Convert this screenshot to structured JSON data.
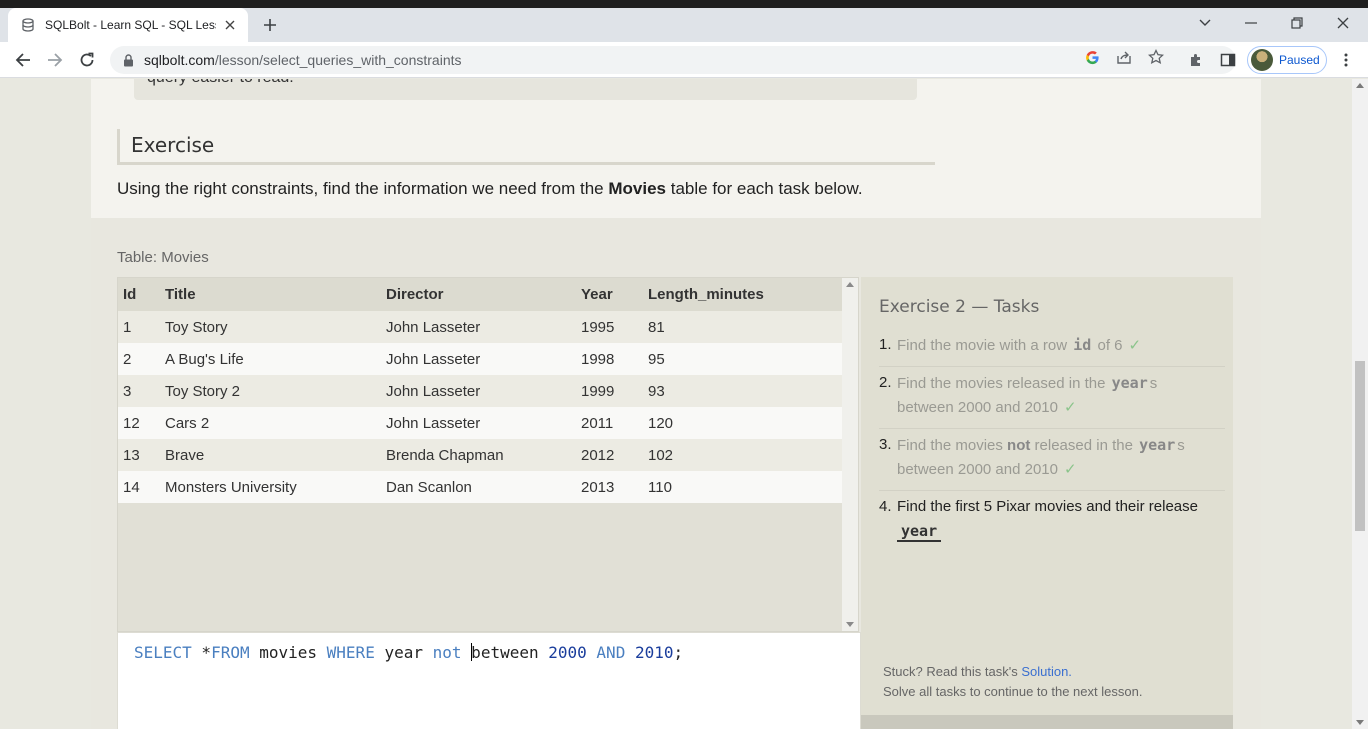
{
  "browser": {
    "tab_title": "SQLBolt - Learn SQL - SQL Lesson",
    "url_host": "sqlbolt.com",
    "url_path": "/lesson/select_queries_with_constraints",
    "profile_label": "Paused"
  },
  "page": {
    "note_fragment": "query easier to read.",
    "exercise_heading": "Exercise",
    "intro_before": "Using the right constraints, find the information we need from the ",
    "intro_bold": "Movies",
    "intro_after": " table for each task below.",
    "table_caption": "Table: Movies"
  },
  "table": {
    "headers": [
      "Id",
      "Title",
      "Director",
      "Year",
      "Length_minutes"
    ],
    "rows": [
      [
        "1",
        "Toy Story",
        "John Lasseter",
        "1995",
        "81"
      ],
      [
        "2",
        "A Bug's Life",
        "John Lasseter",
        "1998",
        "95"
      ],
      [
        "3",
        "Toy Story 2",
        "John Lasseter",
        "1999",
        "93"
      ],
      [
        "12",
        "Cars 2",
        "John Lasseter",
        "2011",
        "120"
      ],
      [
        "13",
        "Brave",
        "Brenda Chapman",
        "2012",
        "102"
      ],
      [
        "14",
        "Monsters University",
        "Dan Scanlon",
        "2013",
        "110"
      ]
    ]
  },
  "editor": {
    "tokens": {
      "select": "SELECT",
      "star": " *",
      "from": "FROM",
      "table": " movies ",
      "where": "WHERE",
      "col": " year ",
      "not": "not",
      "space": " ",
      "between_b": "b",
      "between_rest": "etween ",
      "n1": "2000",
      "and_pre": " ",
      "and": "AND",
      "and_post": " ",
      "n2": "2010",
      "semi": ";"
    }
  },
  "tasks": {
    "title": "Exercise 2 — Tasks",
    "items": [
      {
        "num": "1.",
        "pre": "Find the movie with a row ",
        "code": "id",
        "post": " of 6",
        "check": "✓"
      },
      {
        "num": "2.",
        "pre": "Find the movies released in the ",
        "code": "year",
        "post": "s between 2000 and 2010",
        "check": "✓"
      },
      {
        "num": "3.",
        "pre": "Find the movies ",
        "bold": "not",
        "mid": " released in the ",
        "code": "year",
        "post": "s between 2000 and 2010",
        "check": "✓"
      },
      {
        "num": "4.",
        "pre": "Find the first 5 Pixar movies and their release ",
        "code": "year"
      }
    ],
    "hint_pre": "Stuck? Read this task's ",
    "hint_link": "Solution.",
    "hint_line2": "Solve all tasks to continue to the next lesson."
  }
}
